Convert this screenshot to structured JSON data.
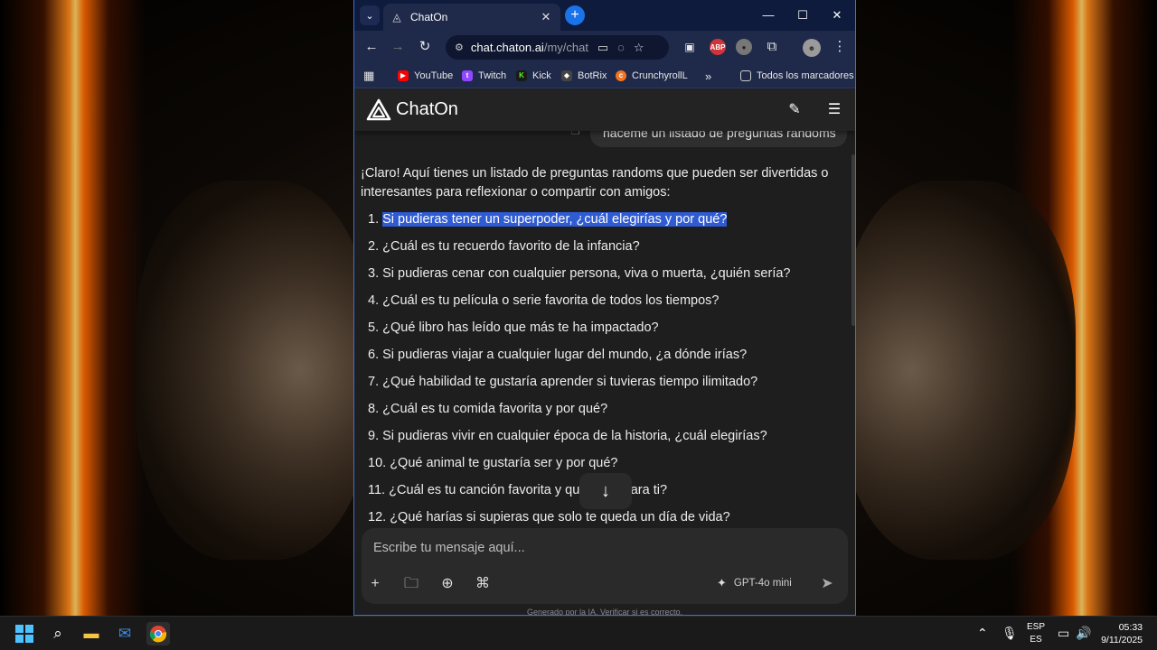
{
  "browser": {
    "tab_title": "ChatOn",
    "url_host": "chat.chaton.ai",
    "url_path": "/my/chat...",
    "bookmarks": [
      "YouTube",
      "Twitch",
      "Kick",
      "BotRix",
      "CrunchyrollL"
    ],
    "all_bookmarks": "Todos los marcadores",
    "ext_abp": "ABP"
  },
  "app": {
    "name": "ChatOn",
    "user_message": "haceme un listado de preguntas randoms",
    "reply_intro": "¡Claro! Aquí tienes un listado de preguntas randoms que pueden ser divertidas o interesantes para reflexionar o compartir con amigos:",
    "questions": [
      {
        "n": "1.",
        "text": "Si pudieras tener un superpoder, ¿cuál elegirías y por qué?"
      },
      {
        "n": "2.",
        "text": "¿Cuál es tu recuerdo favorito de la infancia?"
      },
      {
        "n": "3.",
        "text": "Si pudieras cenar con cualquier persona, viva o muerta, ¿quién sería?"
      },
      {
        "n": "4.",
        "text": "¿Cuál es tu película o serie favorita de todos los tiempos?"
      },
      {
        "n": "5.",
        "text": "¿Qué libro has leído que más te ha impactado?"
      },
      {
        "n": "6.",
        "text": "Si pudieras viajar a cualquier lugar del mundo, ¿a dónde irías?"
      },
      {
        "n": "7.",
        "text": "¿Qué habilidad te gustaría aprender si tuvieras tiempo ilimitado?"
      },
      {
        "n": "8.",
        "text": "¿Cuál es tu comida favorita y por qué?"
      },
      {
        "n": "9.",
        "text": "Si pudieras vivir en cualquier época de la historia, ¿cuál elegirías?"
      },
      {
        "n": "10.",
        "text": "¿Qué animal te gustaría ser y por qué?"
      },
      {
        "n": "11.",
        "text": "¿Cuál es tu canción favorita y qué          para ti?"
      },
      {
        "n": "12.",
        "text": "¿Qué harías si supieras que solo te queda un día de vida?"
      }
    ],
    "composer_placeholder": "Escribe tu mensaje aquí...",
    "model": "GPT-4o mini",
    "footnote": "Generado por la IA. Verificar si es correcto."
  },
  "taskbar": {
    "lang_top": "ESP",
    "lang_bottom": "ES",
    "time": "05:33",
    "date": "9/11/2025"
  },
  "colors": {
    "selection": "#2f5bd3",
    "newtab": "#1a73e8",
    "window_border": "#3d6fd6"
  }
}
